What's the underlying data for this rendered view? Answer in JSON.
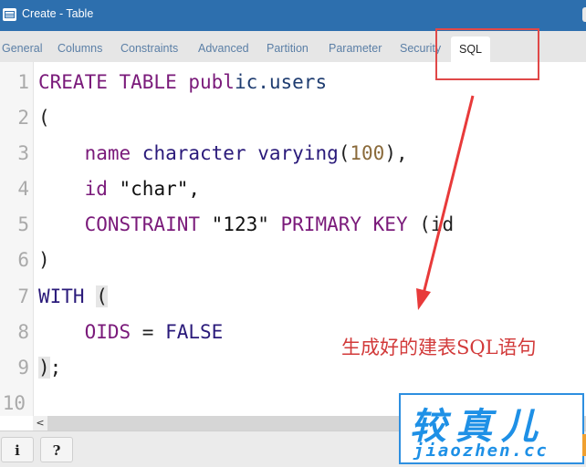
{
  "window": {
    "title": "Create - Table",
    "icon": "table-icon"
  },
  "tabs": [
    {
      "label": "General",
      "active": false
    },
    {
      "label": "Columns",
      "active": false
    },
    {
      "label": "Constraints",
      "active": false
    },
    {
      "label": "Advanced",
      "active": false
    },
    {
      "label": "Partition",
      "active": false
    },
    {
      "label": "Parameter",
      "active": false
    },
    {
      "label": "Security",
      "active": false
    },
    {
      "label": "SQL",
      "active": true
    }
  ],
  "editor": {
    "line_numbers": [
      "1",
      "2",
      "3",
      "4",
      "5",
      "6",
      "7",
      "8",
      "9",
      "10"
    ],
    "lines": {
      "l1": {
        "kw": "CREATE TABLE ",
        "kw_b": "publ",
        "id": "ic.users"
      },
      "l2": {
        "text": "("
      },
      "l3": {
        "indent": "    ",
        "a": "name ",
        "b": "character varying",
        "p1": "(",
        "num": "100",
        "p2": "),"
      },
      "l4": {
        "indent": "    ",
        "a": "id ",
        "str": "\"char\","
      },
      "l5": {
        "indent": "    ",
        "kw": "CONSTRAINT ",
        "str": "\"123\" ",
        "kw2": "PRIMARY KEY ",
        "rest": "(id"
      },
      "l6": {
        "text": ")"
      },
      "l7": {
        "kw": "WITH ",
        "paren": "("
      },
      "l8": {
        "indent": "    ",
        "kw": "OIDS ",
        "eq": "= ",
        "val": "FALSE"
      },
      "l9": {
        "paren": ")",
        "semi": ";"
      },
      "l10": {
        "text": ""
      }
    },
    "scroll_left_arrow": "<"
  },
  "footer": {
    "info_label": "i",
    "help_label": "?"
  },
  "annotation": {
    "text": "生成好的建表SQL语句",
    "color": "#e04848"
  },
  "watermark": {
    "cn": "较真儿",
    "en": "jiaozhen.cc",
    "color": "#1e90e6"
  },
  "colors": {
    "titlebar": "#2d6fae",
    "keyword": "#7a1a7a",
    "keyword2": "#2a1a7a",
    "number": "#8a6a3a"
  }
}
